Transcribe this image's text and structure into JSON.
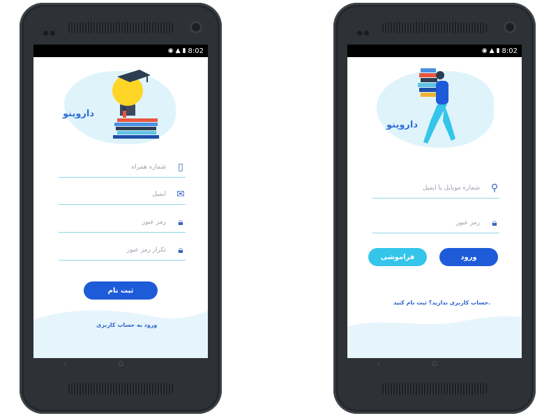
{
  "status": {
    "time": "8:02"
  },
  "signup": {
    "logo": "داروینو",
    "fields": [
      {
        "placeholder": "شماره همراه",
        "icon": "phone-icon"
      },
      {
        "placeholder": "ایمیل",
        "icon": "mail-icon"
      },
      {
        "placeholder": "رمز عبور",
        "icon": "lock-icon"
      },
      {
        "placeholder": "تکرار رمز عبور",
        "icon": "lock-icon"
      }
    ],
    "submit_label": "ثبت نام",
    "login_link": "ورود به حساب کاربری"
  },
  "login": {
    "logo": "داروینو",
    "fields": [
      {
        "placeholder": "شماره موبایل یا ایمیل",
        "icon": "user-icon"
      },
      {
        "placeholder": "رمز عبور",
        "icon": "lock-icon"
      }
    ],
    "login_label": "ورود",
    "forgot_label": "فراموشی",
    "signup_link": "حساب کاربری ندارید؟ ثبت نام کنید."
  },
  "colors": {
    "accent": "#1e5bd8",
    "light_accent": "#35c5ea",
    "blob": "#dff3fb"
  }
}
